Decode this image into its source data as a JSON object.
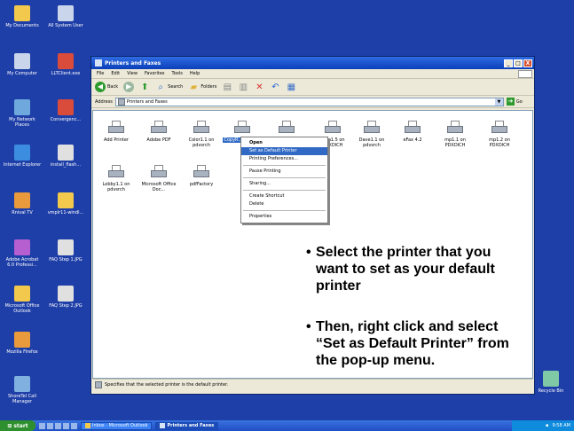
{
  "desktop_icons": [
    {
      "label": "My Documents",
      "icon": "folder-icon",
      "color": "#f2c94c"
    },
    {
      "label": "All System User",
      "icon": "users-icon",
      "color": "#c9d5ea"
    },
    {
      "label": "My Computer",
      "icon": "computer-icon",
      "color": "#c9d5ea"
    },
    {
      "label": "LLTClient.exe",
      "icon": "app-icon",
      "color": "#d94b3a"
    },
    {
      "label": "My Network Places",
      "icon": "network-icon",
      "color": "#6fa8dc"
    },
    {
      "label": "Convergenc...",
      "icon": "document-icon",
      "color": "#d94b3a"
    },
    {
      "label": "Internet Explorer",
      "icon": "ie-icon",
      "color": "#3c8de0"
    },
    {
      "label": "install_flash...",
      "icon": "installer-icon",
      "color": "#e0e0e0"
    },
    {
      "label": "Rnival TV",
      "icon": "tv-icon",
      "color": "#e89a3c"
    },
    {
      "label": "vmplr11-windl...",
      "icon": "installer-icon",
      "color": "#f2c94c"
    },
    {
      "label": "Adobe Acrobat 6.0 Professi...",
      "icon": "acrobat-icon",
      "color": "#b55fd1"
    },
    {
      "label": "FAQ Step 1.JPG",
      "icon": "image-icon",
      "color": "#e0e0e0"
    },
    {
      "label": "Microsoft Office Outlook",
      "icon": "outlook-icon",
      "color": "#f2c94c"
    },
    {
      "label": "FAQ Step 2.JPG",
      "icon": "image-icon",
      "color": "#e0e0e0"
    },
    {
      "label": "Mozilla Firefox",
      "icon": "firefox-icon",
      "color": "#e89a3c"
    },
    {
      "label": "ShoreTel Call Manager",
      "icon": "phone-icon",
      "color": "#7fb0e0"
    },
    {
      "label": "Recycle Bin",
      "icon": "recycle-bin-icon",
      "color": "#7fc9a6"
    }
  ],
  "window": {
    "title": "Printers and Faxes",
    "controls": {
      "minimize": "_",
      "maximize": "□",
      "close": "X"
    },
    "menu": [
      "File",
      "Edit",
      "View",
      "Favorites",
      "Tools",
      "Help"
    ],
    "toolbar": {
      "back": "Back",
      "search": "Search",
      "folders": "Folders"
    },
    "address_label": "Address",
    "address_value": "Printers and Faxes",
    "go": "Go",
    "status": "Specifies that the selected printer is the default printer."
  },
  "printers": [
    {
      "label": "Add Printer",
      "selected": false
    },
    {
      "label": "Adobe PDF",
      "selected": false
    },
    {
      "label": "Color1.1 on pdvsrch",
      "selected": false
    },
    {
      "label": "CopyR... on pd...",
      "selected": true
    },
    {
      "label": "",
      "selected": false
    },
    {
      "label": "Com1.5 on PDXDICH",
      "selected": false
    },
    {
      "label": "Dave1.1 on pdvsrch",
      "selected": false
    },
    {
      "label": "eFax 4.2",
      "selected": false
    },
    {
      "label": "mp1.1 on PDXDICH",
      "selected": false
    },
    {
      "label": "mp1.2 on PDXDICH",
      "selected": false
    },
    {
      "label": "Lobby1.1 on pdvsrch",
      "selected": false
    },
    {
      "label": "Microsoft Office Doc...",
      "selected": false
    },
    {
      "label": "pdfFactory",
      "selected": false
    }
  ],
  "context_menu": [
    {
      "label": "Open",
      "bold": true
    },
    {
      "label": "Set as Default Printer",
      "highlighted": true
    },
    {
      "label": "Printing Preferences..."
    },
    {
      "separator": true
    },
    {
      "label": "Pause Printing"
    },
    {
      "separator": true
    },
    {
      "label": "Sharing..."
    },
    {
      "separator": true
    },
    {
      "label": "Create Shortcut"
    },
    {
      "label": "Delete"
    },
    {
      "separator": true
    },
    {
      "label": "Properties"
    }
  ],
  "instructions": {
    "step1": [
      "Select the printer that you",
      "want to set as your default",
      "printer"
    ],
    "step2": [
      "Then, right click and select",
      "“Set as Default Printer” from",
      "the pop-up menu."
    ],
    "bullet": "•"
  },
  "taskbar": {
    "start": "start",
    "tasks": [
      {
        "label": "Inbox - Microsoft Outlook",
        "active": false
      },
      {
        "label": "Printers and Faxes",
        "active": true
      }
    ],
    "clock": "9:58 AM"
  }
}
